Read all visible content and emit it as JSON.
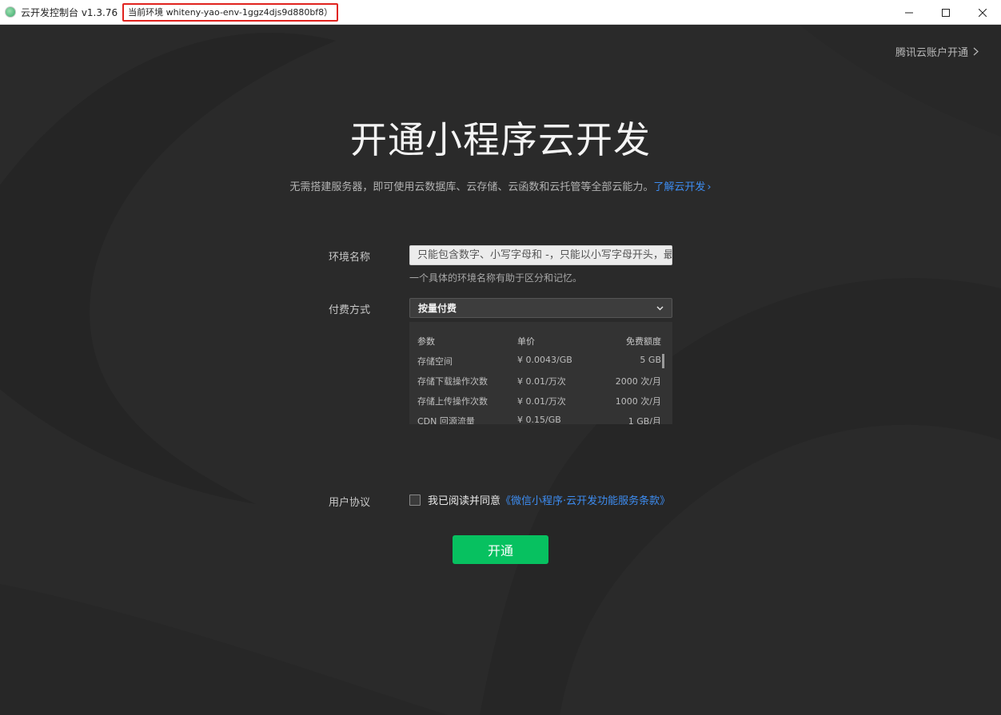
{
  "window": {
    "app_title": "云开发控制台 v1.3.76",
    "env_label": "当前环境 whiteny-yao-env-1ggz4djs9d880bf8）"
  },
  "header": {
    "account_link": "腾讯云账户开通"
  },
  "hero": {
    "title": "开通小程序云开发",
    "description": "无需搭建服务器，即可使用云数据库、云存储、云函数和云托管等全部云能力。",
    "learn_more": "了解云开发"
  },
  "form": {
    "env_name_label": "环境名称",
    "env_name_placeholder": "只能包含数字、小写字母和 -，只能以小写字母开头，最多",
    "env_name_hint": "一个具体的环境名称有助于区分和记忆。",
    "payment_label": "付费方式",
    "payment_value": "按量付费",
    "price_table": {
      "headers": [
        "参数",
        "单价",
        "免费额度"
      ],
      "rows": [
        [
          "存储空间",
          "¥ 0.0043/GB",
          "5 GB"
        ],
        [
          "存储下载操作次数",
          "¥ 0.01/万次",
          "2000 次/月"
        ],
        [
          "存储上传操作次数",
          "¥ 0.01/万次",
          "1000 次/月"
        ],
        [
          "CDN 回源流量",
          "¥ 0.15/GB",
          "1 GB/月"
        ]
      ]
    },
    "agreement_label": "用户协议",
    "agreement_text": "我已阅读并同意",
    "agreement_link": "《微信小程序·云开发功能服务条款》",
    "submit_label": "开通"
  },
  "colors": {
    "accent_green": "#07c160",
    "link_blue": "#3d8cf0",
    "highlight_red": "#e0231e",
    "background": "#2a2a2a"
  }
}
